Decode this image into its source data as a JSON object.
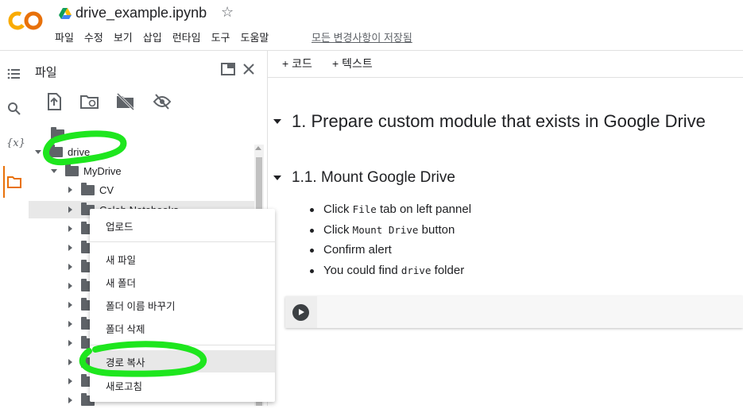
{
  "app": {
    "logo_text": "CO",
    "document_title": "drive_example.ipynb",
    "saved_status": "모든 변경사항이 저장됨"
  },
  "menu": [
    "파일",
    "수정",
    "보기",
    "삽입",
    "런타임",
    "도구",
    "도움말"
  ],
  "sidebar": {
    "title": "파일"
  },
  "tree": {
    "parent": "..",
    "drive": "drive",
    "mydrive": "MyDrive",
    "cv": "CV",
    "colab": "Colab Notebooks"
  },
  "context_menu": {
    "upload": "업로드",
    "new_file": "새 파일",
    "new_folder": "새 폴더",
    "rename_folder": "폴더 이름 바꾸기",
    "delete_folder": "폴더 삭제",
    "copy_path": "경로 복사",
    "refresh": "새로고침"
  },
  "notebook": {
    "add_code": "+ 코드",
    "add_text": "+ 텍스트",
    "h1": "1. Prepare custom module that exists in Google Drive",
    "h2": "1.1. Mount Google Drive",
    "b1_pre": "Click ",
    "b1_code": "File",
    "b1_post": " tab on left pannel",
    "b2_pre": "Click ",
    "b2_code": "Mount Drive",
    "b2_post": " button",
    "b3": "Confirm alert",
    "b4_pre": "You could find ",
    "b4_code": "drive",
    "b4_post": " folder"
  },
  "colors": {
    "logo_orange": "#f9ab00",
    "logo_dark": "#e8710a",
    "annotation_green": "#1ee61e"
  }
}
